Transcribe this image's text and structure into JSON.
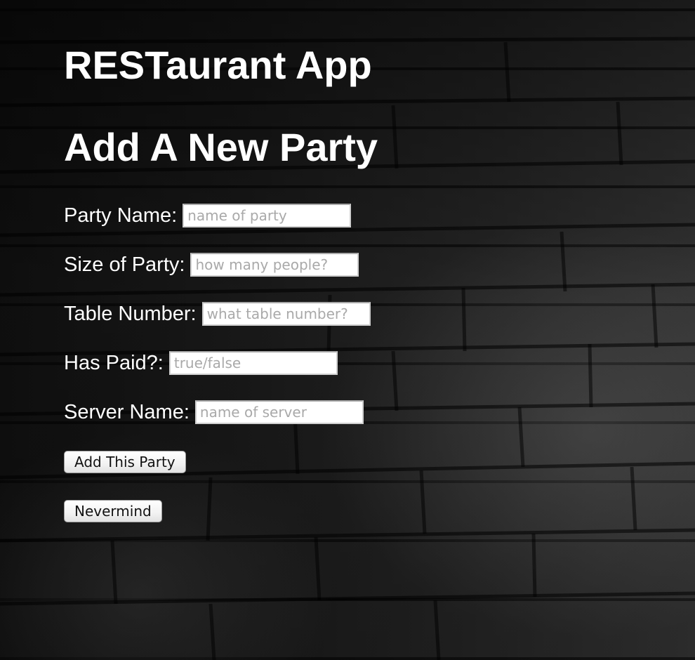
{
  "header": {
    "app_title": "RESTaurant App",
    "page_heading": "Add A New Party"
  },
  "form": {
    "fields": [
      {
        "label": "Party Name:",
        "placeholder": "name of party",
        "value": ""
      },
      {
        "label": "Size of Party:",
        "placeholder": "how many people?",
        "value": ""
      },
      {
        "label": "Table Number:",
        "placeholder": "what table number?",
        "value": ""
      },
      {
        "label": "Has Paid?:",
        "placeholder": "true/false",
        "value": ""
      },
      {
        "label": "Server Name:",
        "placeholder": "name of server",
        "value": ""
      }
    ],
    "submit_label": "Add This Party",
    "cancel_label": "Nevermind"
  },
  "colors": {
    "text": "#ffffff",
    "background": "#161616",
    "input_border": "#cfcfcf",
    "placeholder": "#a9a9a9"
  }
}
